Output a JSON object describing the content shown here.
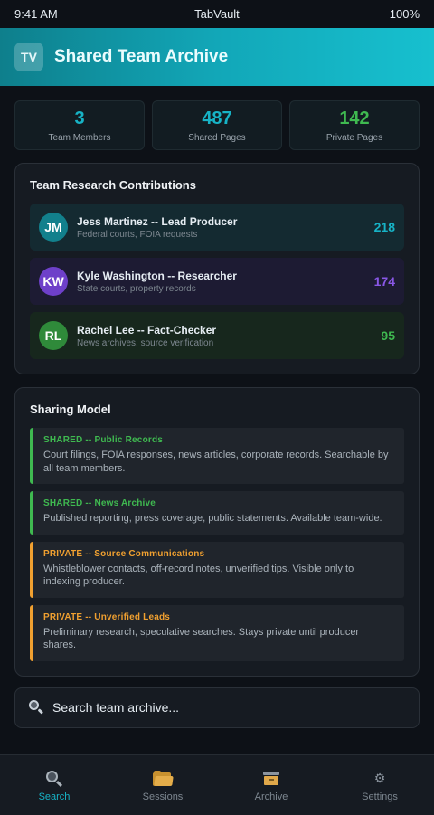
{
  "status_bar": {
    "time": "9:41 AM",
    "app_name": "TabVault",
    "battery": "100%"
  },
  "header": {
    "logo_text": "TV",
    "title": "Shared Team Archive"
  },
  "stats": [
    {
      "value": "3",
      "label": "Team Members",
      "color": "#17b3c6"
    },
    {
      "value": "487",
      "label": "Shared Pages",
      "color": "#17b3c6"
    },
    {
      "value": "142",
      "label": "Private Pages",
      "color": "#3fb950"
    }
  ],
  "contributions": {
    "title": "Team Research Contributions",
    "members": [
      {
        "initials": "JM",
        "name": "Jess Martinez -- Lead Producer",
        "focus": "Federal courts, FOIA requests",
        "count": "218",
        "color": "#17b3c6"
      },
      {
        "initials": "KW",
        "name": "Kyle Washington -- Researcher",
        "focus": "State courts, property records",
        "count": "174",
        "color": "#8957e5"
      },
      {
        "initials": "RL",
        "name": "Rachel Lee -- Fact-Checker",
        "focus": "News archives, source verification",
        "count": "95",
        "color": "#3fb950"
      }
    ]
  },
  "sharing_model": {
    "title": "Sharing Model",
    "policies": [
      {
        "title": "SHARED -- Public Records",
        "description": "Court filings, FOIA responses, news articles, corporate records. Searchable by all team members.",
        "type": "shared",
        "color": "#3fb950"
      },
      {
        "title": "SHARED -- News Archive",
        "description": "Published reporting, press coverage, public statements. Available team-wide.",
        "type": "shared",
        "color": "#3fb950"
      },
      {
        "title": "PRIVATE -- Source Communications",
        "description": "Whistleblower contacts, off-record notes, unverified tips. Visible only to indexing producer.",
        "type": "private",
        "color": "#f0a030"
      },
      {
        "title": "PRIVATE -- Unverified Leads",
        "description": "Preliminary research, speculative searches. Stays private until producer shares.",
        "type": "private",
        "color": "#f0a030"
      }
    ]
  },
  "search": {
    "placeholder": "Search team archive..."
  },
  "tabbar": {
    "tabs": [
      {
        "label": "Search",
        "icon": "search-icon",
        "active": true
      },
      {
        "label": "Sessions",
        "icon": "folder-icon",
        "active": false
      },
      {
        "label": "Archive",
        "icon": "archive-box-icon",
        "active": false
      },
      {
        "label": "Settings",
        "icon": "gear-icon",
        "active": false
      }
    ]
  }
}
